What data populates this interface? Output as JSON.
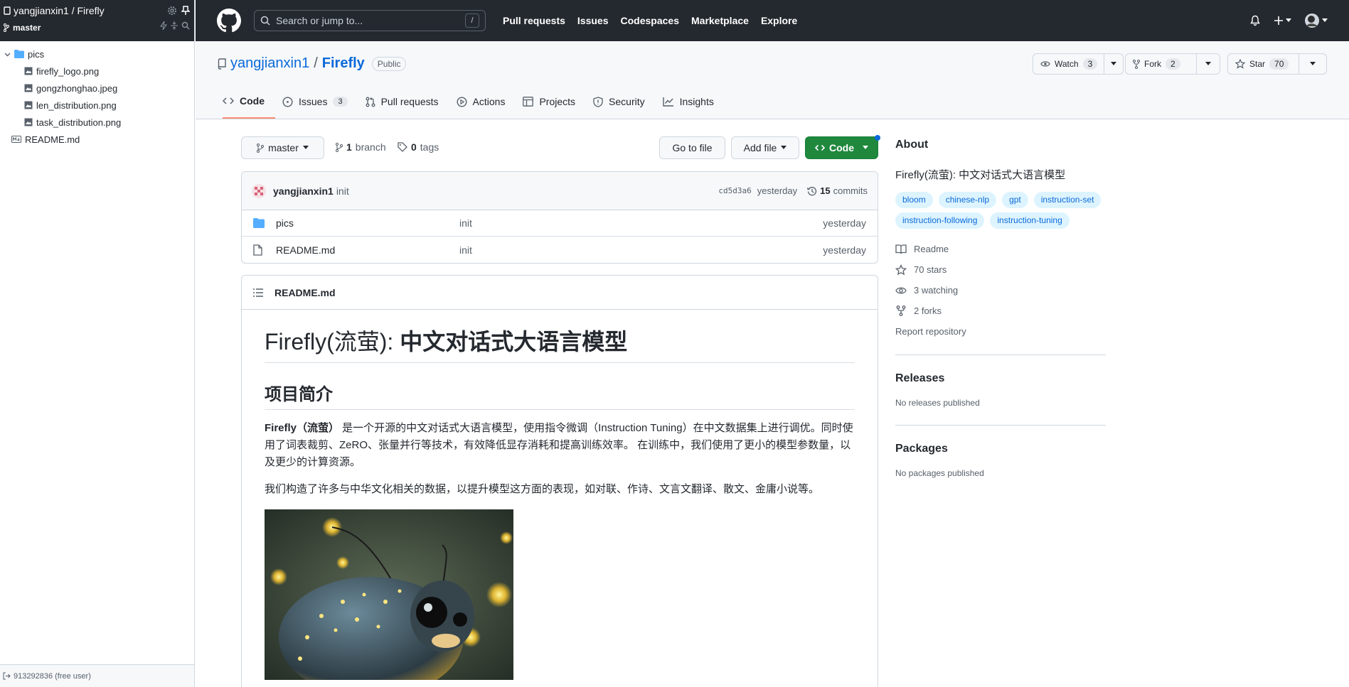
{
  "sidebar": {
    "repo": "yangjianxin1 / Firefly",
    "branch": "master",
    "tree": [
      {
        "label": "pics",
        "type": "folder",
        "indent": 0
      },
      {
        "label": "firefly_logo.png",
        "type": "image",
        "indent": 1
      },
      {
        "label": "gongzhonghao.jpeg",
        "type": "image",
        "indent": 1
      },
      {
        "label": "len_distribution.png",
        "type": "image",
        "indent": 1
      },
      {
        "label": "task_distribution.png",
        "type": "image",
        "indent": 1
      },
      {
        "label": "README.md",
        "type": "markdown",
        "indent": 0
      }
    ],
    "footer": "913292836 (free user)"
  },
  "header": {
    "search_placeholder": "Search or jump to...",
    "search_shortcut": "/",
    "nav": [
      "Pull requests",
      "Issues",
      "Codespaces",
      "Marketplace",
      "Explore"
    ]
  },
  "repo": {
    "owner": "yangjianxin1",
    "separator": "/",
    "name": "Firefly",
    "visibility": "Public",
    "watch": {
      "label": "Watch",
      "count": "3"
    },
    "fork": {
      "label": "Fork",
      "count": "2"
    },
    "star": {
      "label": "Star",
      "count": "70"
    }
  },
  "tabs": [
    {
      "label": "Code",
      "icon": "code-icon",
      "counter": ""
    },
    {
      "label": "Issues",
      "icon": "issue-icon",
      "counter": "3"
    },
    {
      "label": "Pull requests",
      "icon": "pull-request-icon",
      "counter": ""
    },
    {
      "label": "Actions",
      "icon": "play-icon",
      "counter": ""
    },
    {
      "label": "Projects",
      "icon": "table-icon",
      "counter": ""
    },
    {
      "label": "Security",
      "icon": "shield-icon",
      "counter": ""
    },
    {
      "label": "Insights",
      "icon": "graph-icon",
      "counter": ""
    }
  ],
  "toolbar": {
    "branch": "master",
    "branch_count": "1",
    "branch_label": "branch",
    "tags_count": "0",
    "tags_label": "tags",
    "go_to_file": "Go to file",
    "add_file": "Add file",
    "code": "Code"
  },
  "commit": {
    "author": "yangjianxin1",
    "message": "init",
    "sha": "cd5d3a6",
    "time": "yesterday",
    "count": "15",
    "count_label": "commits"
  },
  "files": [
    {
      "name": "pics",
      "type": "folder",
      "message": "init",
      "date": "yesterday"
    },
    {
      "name": "README.md",
      "type": "file",
      "message": "init",
      "date": "yesterday"
    }
  ],
  "readme": {
    "filename": "README.md",
    "h1_prefix": "Firefly(流萤): ",
    "h1_main": "中文对话式大语言模型",
    "h2": "项目简介",
    "p1_bold": "Firefly（流萤）",
    "p1_rest": " 是一个开源的中文对话式大语言模型，使用指令微调（Instruction Tuning）在中文数据集上进行调优。同时使用了词表裁剪、ZeRO、张量并行等技术，有效降低显存消耗和提高训练效率。 在训练中，我们使用了更小的模型参数量，以及更少的计算资源。",
    "p2": "我们构造了许多与中华文化相关的数据，以提升模型这方面的表现，如对联、作诗、文言文翻译、散文、金庸小说等。"
  },
  "about": {
    "title": "About",
    "description": "Firefly(流萤): 中文对话式大语言模型",
    "topics": [
      "bloom",
      "chinese-nlp",
      "gpt",
      "instruction-set",
      "instruction-following",
      "instruction-tuning"
    ],
    "meta": [
      {
        "icon": "book-icon",
        "label": "Readme"
      },
      {
        "icon": "star-icon",
        "label": "70 stars"
      },
      {
        "icon": "eye-icon",
        "label": "3 watching"
      },
      {
        "icon": "fork-icon",
        "label": "2 forks"
      }
    ],
    "report": "Report repository",
    "releases_title": "Releases",
    "releases_sub": "No releases published",
    "packages_title": "Packages",
    "packages_sub": "No packages published"
  },
  "colors": {
    "header_bg": "#24292f",
    "link": "#0969da",
    "code_button": "#1f883d",
    "active_tab": "#fd8c73"
  }
}
